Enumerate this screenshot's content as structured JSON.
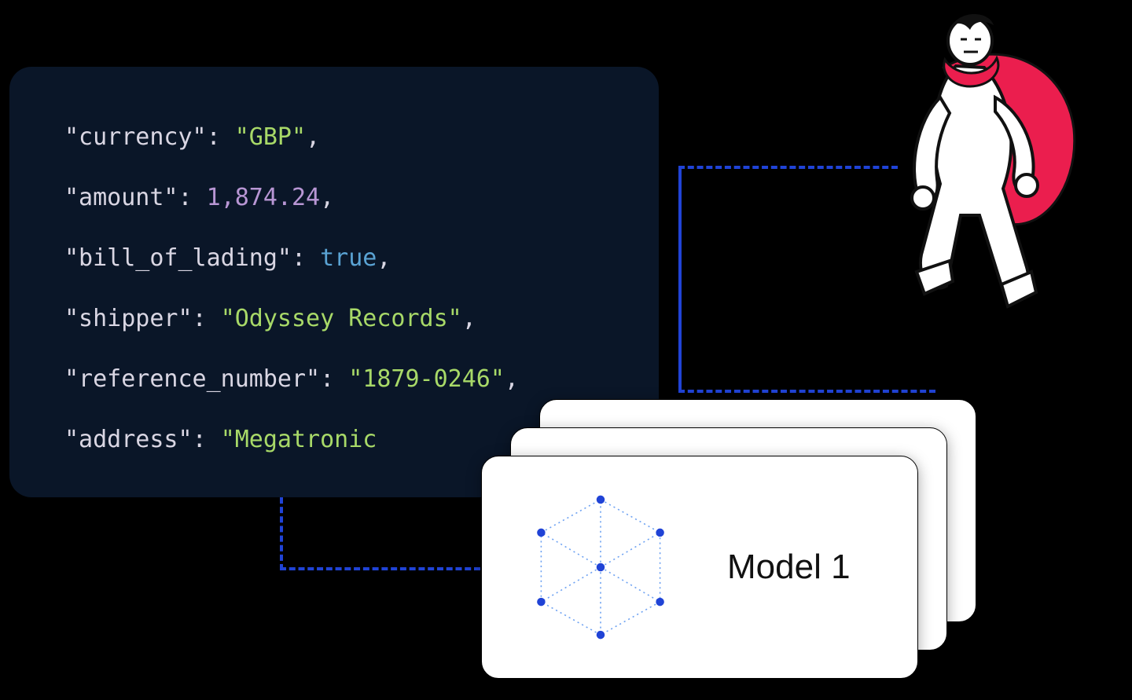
{
  "json_data": {
    "lines": [
      {
        "key": "\"currency\"",
        "value": "\"GBP\"",
        "value_class": "json-str"
      },
      {
        "key": "\"amount\"",
        "value": "1,874.24",
        "value_class": "json-num"
      },
      {
        "key": "\"bill_of_lading\"",
        "value": "true",
        "value_class": "json-bool"
      },
      {
        "key": "\"shipper\"",
        "value": "\"Odyssey Records\"",
        "value_class": "json-str"
      },
      {
        "key": "\"reference_number\"",
        "value": "\"1879-0246\"",
        "value_class": "json-str"
      },
      {
        "key": "\"address\"",
        "value": "\"Megatronic",
        "value_class": "json-str",
        "no_trailing_comma": true
      }
    ]
  },
  "model_card": {
    "label": "Model 1"
  },
  "colors": {
    "connector": "#2043d6",
    "code_bg": "#0a1628",
    "string": "#a8d968",
    "number": "#b896d4",
    "boolean": "#5aa3d4"
  }
}
